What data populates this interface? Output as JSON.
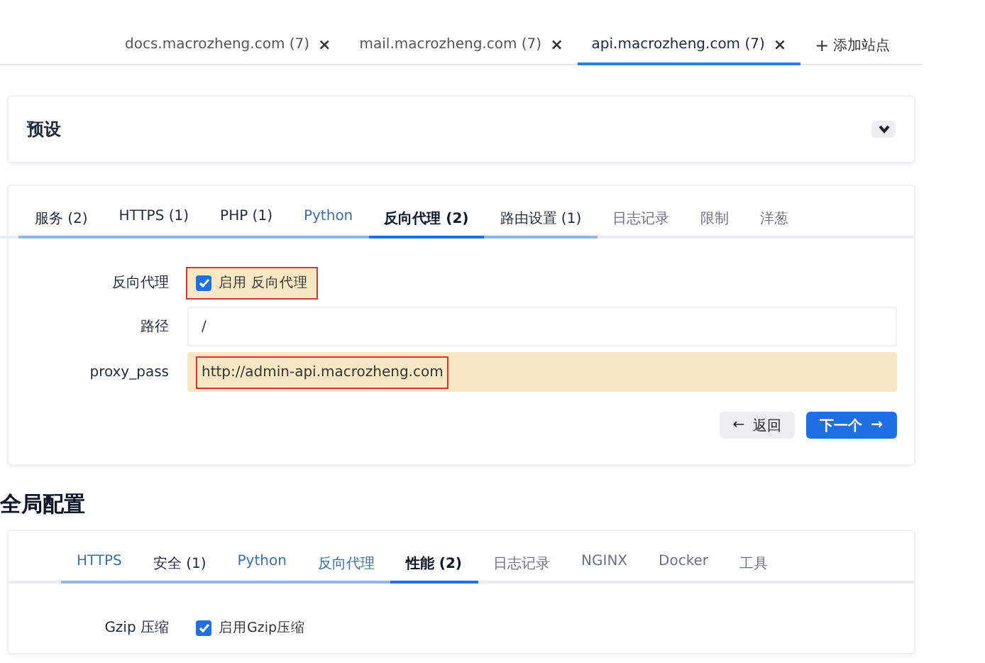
{
  "site_tabs": [
    {
      "label": "docs.macrozheng.com (7)",
      "close": "×",
      "selected": false
    },
    {
      "label": "mail.macrozheng.com (7)",
      "close": "×",
      "selected": false
    },
    {
      "label": "api.macrozheng.com (7)",
      "close": "×",
      "selected": true
    }
  ],
  "add_site": {
    "icon": "+",
    "label": "添加站点"
  },
  "preset_card": {
    "title": "预设",
    "expanded": false
  },
  "site_config": {
    "tabs": [
      {
        "label": "服务 (2)",
        "visited": true,
        "configured": true,
        "selected": false
      },
      {
        "label": "HTTPS (1)",
        "visited": true,
        "configured": true,
        "selected": false
      },
      {
        "label": "PHP (1)",
        "visited": true,
        "configured": true,
        "selected": false
      },
      {
        "label": "Python",
        "visited": true,
        "configured": false,
        "selected": false
      },
      {
        "label": "反向代理 (2)",
        "visited": true,
        "configured": true,
        "selected": true
      },
      {
        "label": "路由设置 (1)",
        "visited": true,
        "configured": true,
        "selected": false
      },
      {
        "label": "日志记录",
        "visited": false,
        "configured": false,
        "selected": false
      },
      {
        "label": "限制",
        "visited": false,
        "configured": false,
        "selected": false
      },
      {
        "label": "洋葱",
        "visited": false,
        "configured": false,
        "selected": false
      }
    ],
    "fields": [
      {
        "kind": "checkbox",
        "label": "反向代理",
        "option": "启用 反向代理",
        "checked": true,
        "modified": true,
        "annotated": true
      },
      {
        "kind": "text",
        "label": "路径",
        "value": "/",
        "modified": false,
        "annotated": false
      },
      {
        "kind": "text",
        "label": "proxy_pass",
        "value": "http://admin-api.macrozheng.com",
        "modified": true,
        "annotated": true
      }
    ],
    "back_button": {
      "icon": "←",
      "label": "返回"
    },
    "next_button": {
      "label": "下一个",
      "icon": "→"
    }
  },
  "global_heading": "全局配置",
  "global_config": {
    "tabs": [
      {
        "label": "HTTPS",
        "visited": true,
        "configured": false,
        "selected": false
      },
      {
        "label": "安全 (1)",
        "visited": true,
        "configured": true,
        "selected": false
      },
      {
        "label": "Python",
        "visited": true,
        "configured": false,
        "selected": false
      },
      {
        "label": "反向代理",
        "visited": true,
        "configured": false,
        "selected": false
      },
      {
        "label": "性能 (2)",
        "visited": true,
        "configured": true,
        "selected": true
      },
      {
        "label": "日志记录",
        "visited": false,
        "configured": false,
        "selected": false
      },
      {
        "label": "NGINX",
        "visited": false,
        "configured": false,
        "selected": false
      },
      {
        "label": "Docker",
        "visited": false,
        "configured": false,
        "selected": false
      },
      {
        "label": "工具",
        "visited": false,
        "configured": false,
        "selected": false
      }
    ],
    "fields": [
      {
        "kind": "checkbox",
        "label": "Gzip 压缩",
        "option": "启用Gzip压缩",
        "checked": true,
        "modified": false,
        "annotated": false
      }
    ]
  }
}
